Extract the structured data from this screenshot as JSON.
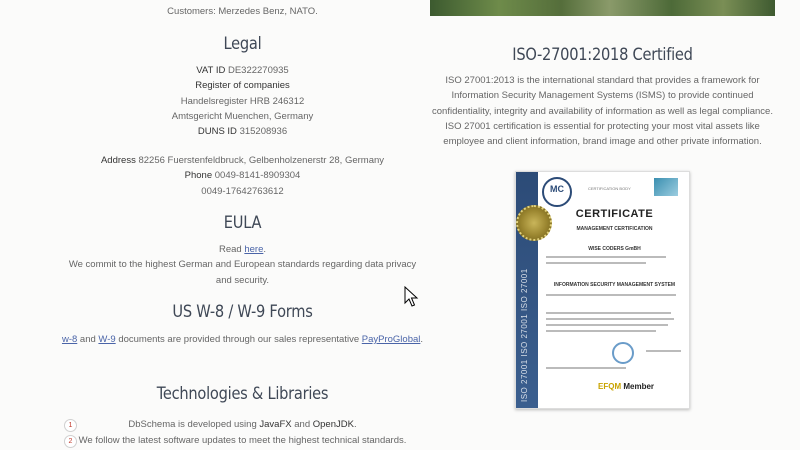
{
  "left": {
    "customers_line": "Customers: Merzedes Benz, NATO.",
    "legal": {
      "title": "Legal",
      "vat_label": "VAT ID",
      "vat_value": "DE322270935",
      "register_label": "Register of companies",
      "register_line1": "Handelsregister HRB 246312",
      "register_line2": "Amtsgericht Muenchen, Germany",
      "duns_label": "DUNS ID",
      "duns_value": "315208936",
      "address_label": "Address",
      "address_value": "82256 Fuerstenfeldbruck, Gelbenholzenerstr 28, Germany",
      "phone_label": "Phone",
      "phone_value1": "0049-8141-8909304",
      "phone_value2": "0049-17642763612"
    },
    "eula": {
      "title": "EULA",
      "read_prefix": "Read",
      "read_link": "here",
      "read_suffix": ".",
      "commitment": "We commit to the highest German and European standards regarding data privacy and security."
    },
    "w8": {
      "title": "US W-8 / W-9 Forms",
      "link_w8": "w-8",
      "text_and": "and",
      "link_w9": "W-9",
      "text_middle": "documents are provided through our sales representative",
      "link_payprogobal": "PayProGlobal",
      "text_end": "."
    },
    "tech": {
      "title": "Technologies & Libraries",
      "items": [
        {
          "num": "1",
          "prefix": "DbSchema is developed using",
          "java": "JavaFX",
          "and": "and",
          "jdk": "OpenJDK",
          "suffix": "."
        },
        {
          "num": "2",
          "text": "We follow the latest software updates to meet the highest technical standards."
        }
      ]
    }
  },
  "right": {
    "iso_title": "ISO-27001:2018 Certified",
    "iso_text": "ISO 27001:2013 is the international standard that provides a framework for Information Security Management Systems (ISMS) to provide continued confidentiality, integrity and availability of information as well as legal compliance. ISO 27001 certification is essential for protecting your most vital assets like employee and client information, brand image and other private information.",
    "certificate": {
      "side_label": "ISO 27001 ISO 27001 ISO 27001",
      "mc_logo": "MC",
      "cert_body": "CERTIFICATION BODY",
      "title": "CERTIFICATE",
      "subtitle": "MANAGEMENT CERTIFICATION",
      "company": "WISE CODERS GmBH",
      "system": "INFORMATION SECURITY MANAGEMENT SYSTEM",
      "efqm_prefix": "EFQM",
      "efqm_member": "Member"
    }
  }
}
